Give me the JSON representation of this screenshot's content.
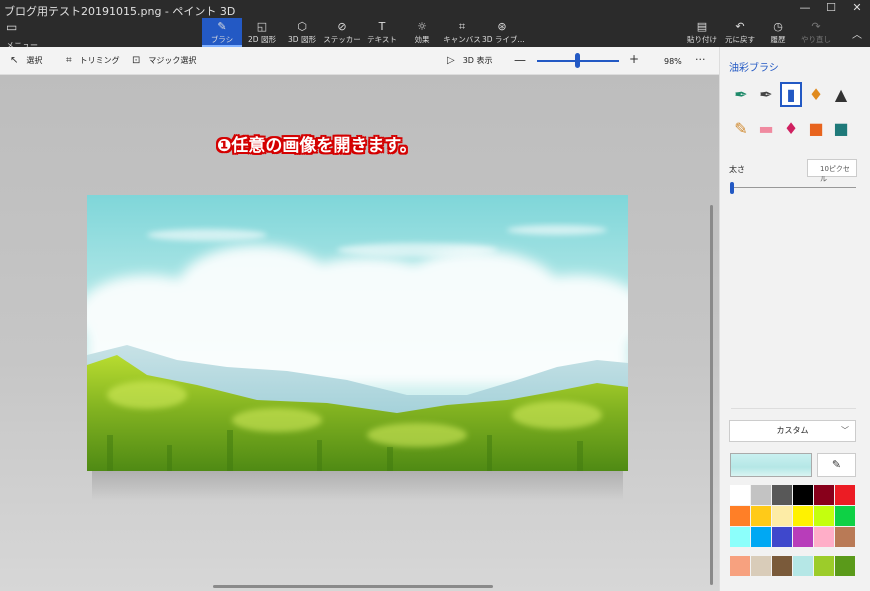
{
  "window": {
    "title": "ブログ用テスト20191015.png - ペイント 3D",
    "controls": [
      "minimize",
      "maximize",
      "close"
    ]
  },
  "ribbon": {
    "menu_label": "メニュー",
    "tools": [
      {
        "label": "ブラシ",
        "icon": "brush-icon",
        "active": true
      },
      {
        "label": "2D 図形",
        "icon": "2d-shapes-icon",
        "active": false
      },
      {
        "label": "3D 図形",
        "icon": "3d-shapes-icon",
        "active": false
      },
      {
        "label": "ステッカー",
        "icon": "sticker-icon",
        "active": false
      },
      {
        "label": "テキスト",
        "icon": "text-icon",
        "active": false
      },
      {
        "label": "効果",
        "icon": "effects-icon",
        "active": false
      },
      {
        "label": "キャンバス",
        "icon": "canvas-icon",
        "active": false
      },
      {
        "label": "3D ライブ...",
        "icon": "3d-library-icon",
        "active": false
      }
    ],
    "right_tools": [
      {
        "label": "貼り付け",
        "icon": "paste-icon",
        "enabled": true
      },
      {
        "label": "元に戻す",
        "icon": "undo-icon",
        "enabled": true
      },
      {
        "label": "履歴",
        "icon": "history-icon",
        "enabled": true
      },
      {
        "label": "やり直し",
        "icon": "redo-icon",
        "enabled": false
      }
    ]
  },
  "toolbar": {
    "select_label": "選択",
    "crop_label": "トリミング",
    "magic_select_label": "マジック選択",
    "view3d_label": "3D 表示",
    "zoom_value": "98%",
    "zoom_level": 0.5
  },
  "canvas": {
    "annotation": "❶任意の画像を開きます。"
  },
  "panel": {
    "title": "油彩ブラシ",
    "brushes": [
      {
        "name": "marker-icon",
        "glyph": "✒",
        "color": "#1f8a6a",
        "selected": false
      },
      {
        "name": "calligraphy-pen-icon",
        "glyph": "✒",
        "color": "#444444",
        "selected": false
      },
      {
        "name": "oil-brush-icon",
        "glyph": "▮",
        "color": "#2359c4",
        "selected": true
      },
      {
        "name": "watercolor-icon",
        "glyph": "♦",
        "color": "#e08a1e",
        "selected": false
      },
      {
        "name": "pixel-pen-icon",
        "glyph": "▲",
        "color": "#333333",
        "selected": false
      },
      {
        "name": "pencil-icon",
        "glyph": "✎",
        "color": "#d08a30",
        "selected": false
      },
      {
        "name": "eraser-icon",
        "glyph": "▬",
        "color": "#f08aa0",
        "selected": false
      },
      {
        "name": "crayon-icon",
        "glyph": "♦",
        "color": "#d02060",
        "selected": false
      },
      {
        "name": "spray-can-icon",
        "glyph": "■",
        "color": "#e8641e",
        "selected": false
      },
      {
        "name": "fill-icon",
        "glyph": "■",
        "color": "#1f7a7a",
        "selected": false
      }
    ],
    "thickness_label": "太さ",
    "thickness_value": "10ピクセル",
    "color_mode": "カスタム",
    "current_color": "#b5e7e6",
    "palette": [
      "#ffffff",
      "#c3c3c3",
      "#585858",
      "#000000",
      "#88001b",
      "#ec1c24",
      "#ff7f27",
      "#ffca18",
      "#fdeca6",
      "#fff200",
      "#c4ff0e",
      "#0ed145",
      "#8cfffb",
      "#00a8f3",
      "#3f48cc",
      "#b83dba",
      "#ffaec8",
      "#b97a56"
    ],
    "custom_colors": [
      "#f7a17f",
      "#d9ccb9",
      "#7a5a3a",
      "#b5e7e6",
      "#9ccc2a",
      "#5a9a1a"
    ]
  }
}
